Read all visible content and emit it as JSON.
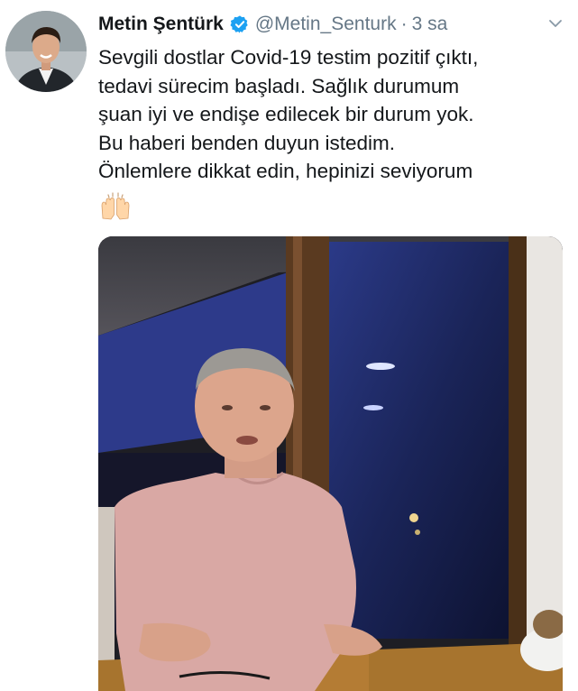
{
  "tweet": {
    "author": {
      "display_name": "Metin Şentürk",
      "handle": "@Metin_Senturk",
      "separator": "·",
      "time": "3 sa"
    },
    "body_lines": [
      "Sevgili dostlar Covid-19 testim pozitif çıktı,",
      "tedavi sürecim başladı. Sağlık durumum",
      "şuan iyi ve endişe edilecek bir durum yok.",
      "Bu haberi benden duyun istedim.",
      "Önlemlere dikkat edin, hepinizi seviyorum"
    ],
    "emoji": "raising-hands-emoji",
    "icons": {
      "verified": "verified-badge-icon",
      "more": "chevron-down-icon"
    },
    "colors": {
      "verified_blue": "#1da1f2",
      "muted_text": "#657786",
      "text": "#14171a"
    }
  }
}
